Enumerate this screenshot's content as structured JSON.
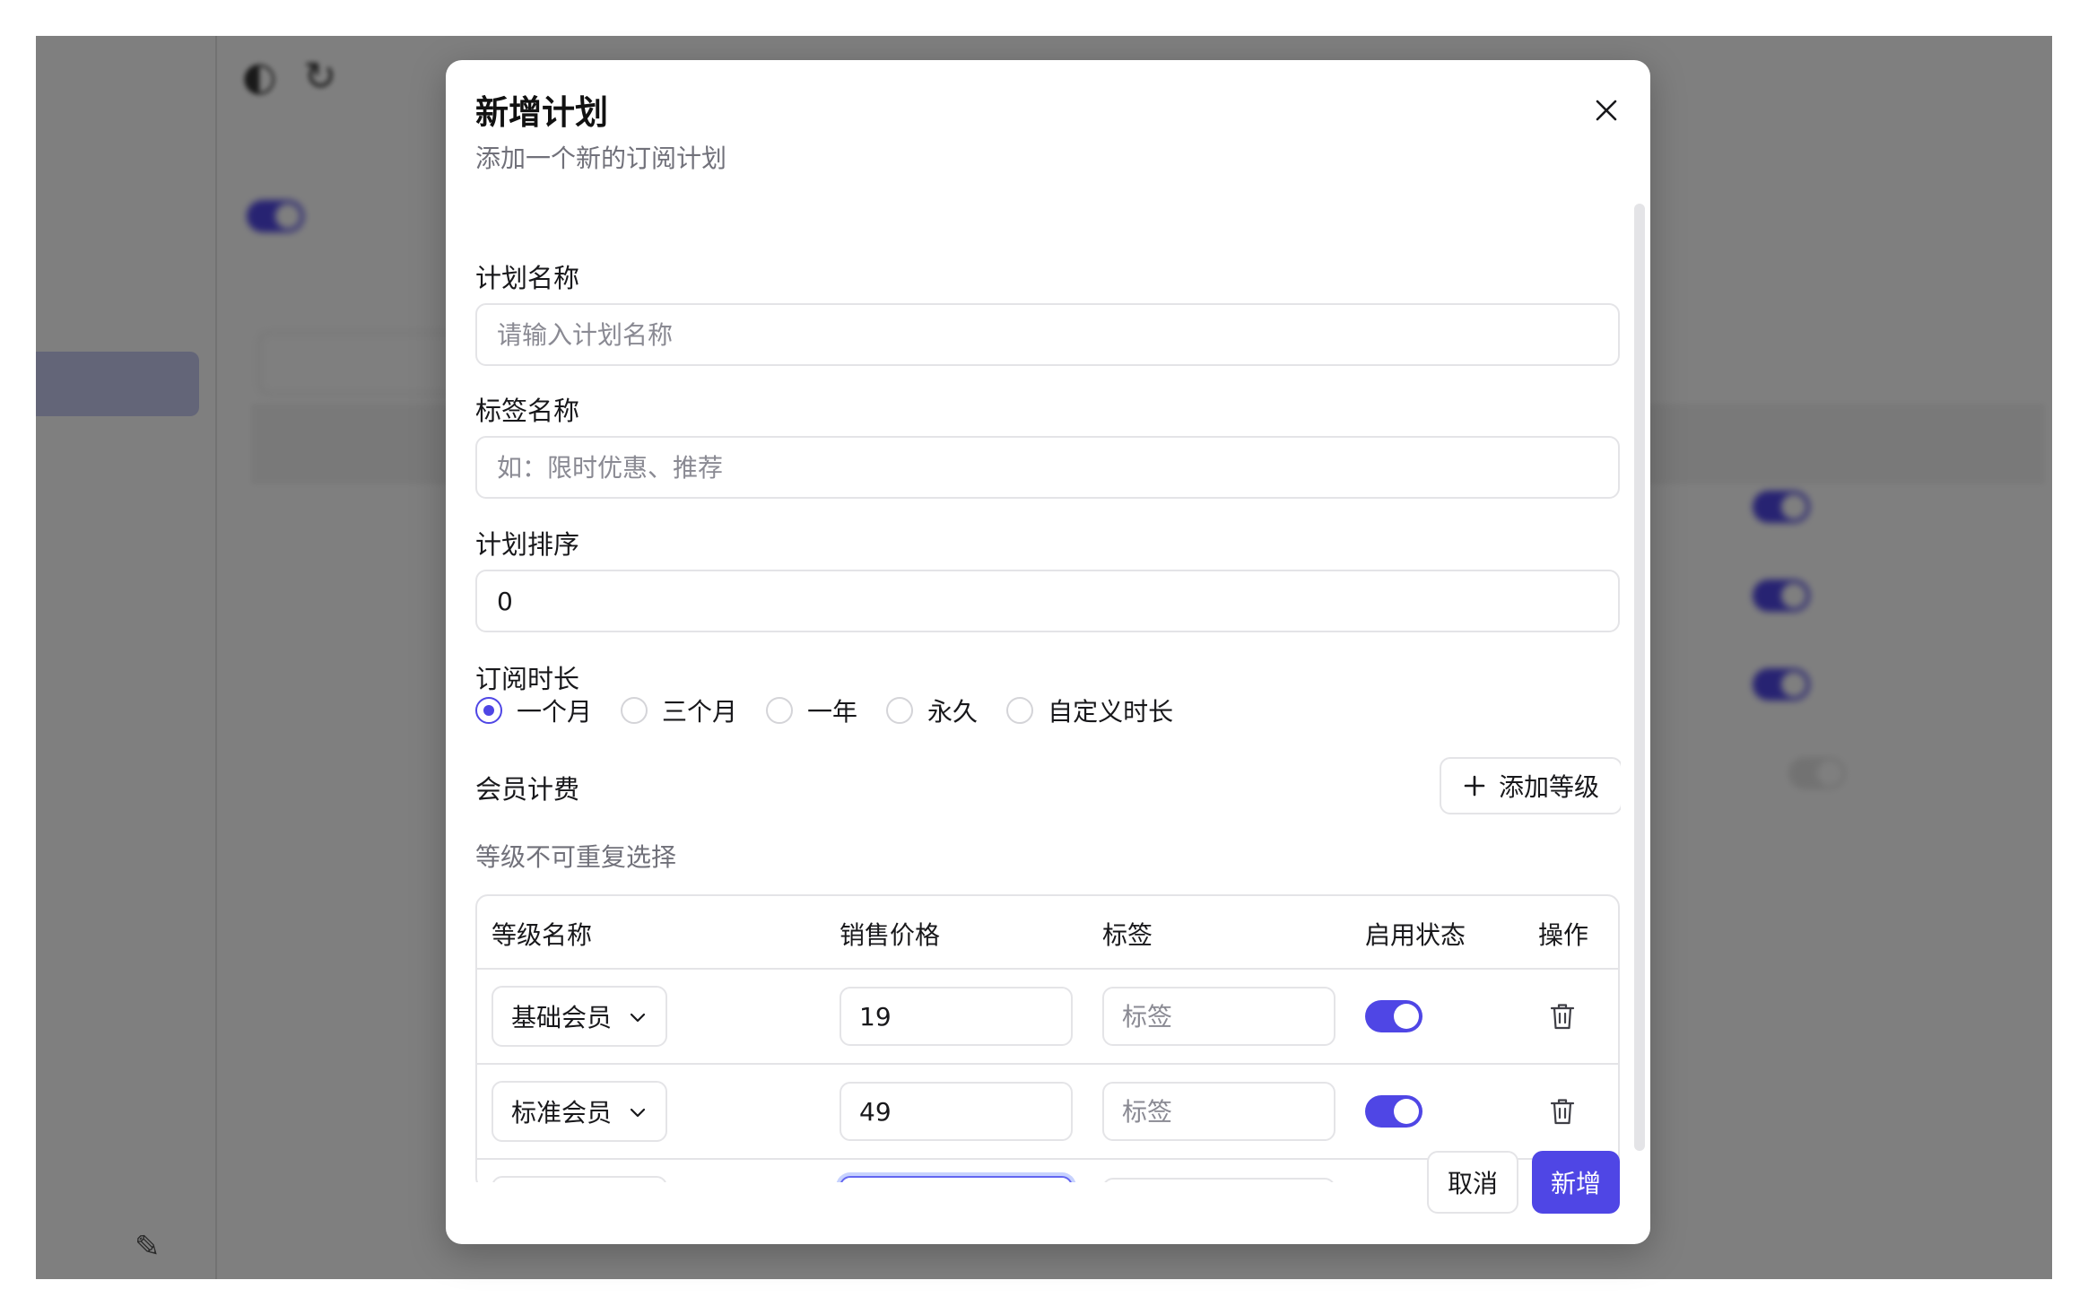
{
  "dialog": {
    "title": "新增计划",
    "description": "添加一个新的订阅计划"
  },
  "form": {
    "plan_name": {
      "label": "计划名称",
      "placeholder": "请输入计划名称",
      "value": ""
    },
    "tag_name": {
      "label": "标签名称",
      "placeholder": "如：限时优惠、推荐",
      "value": ""
    },
    "plan_order": {
      "label": "计划排序",
      "value": "0"
    },
    "duration": {
      "label": "订阅时长",
      "options": [
        "一个月",
        "三个月",
        "一年",
        "永久",
        "自定义时长"
      ],
      "selected": "一个月"
    },
    "membership": {
      "label": "会员计费",
      "add_button": "添加等级",
      "hint": "等级不可重复选择"
    }
  },
  "tiers_table": {
    "headers": [
      "等级名称",
      "销售价格",
      "标签",
      "启用状态",
      "操作"
    ],
    "rows": [
      {
        "level": "基础会员",
        "price": "19",
        "tag_placeholder": "标签",
        "enabled": true
      },
      {
        "level": "标准会员",
        "price": "49",
        "tag_placeholder": "标签",
        "enabled": true
      }
    ]
  },
  "footer": {
    "cancel": "取消",
    "submit": "新增"
  },
  "colors": {
    "accent": "#4f46e5",
    "overlay": "rgba(0,0,0,0.5)",
    "border": "#e4e4e7",
    "muted_text": "#71717a"
  },
  "icons": [
    "close-icon",
    "plus-icon",
    "chevron-down-icon",
    "trash-icon"
  ]
}
